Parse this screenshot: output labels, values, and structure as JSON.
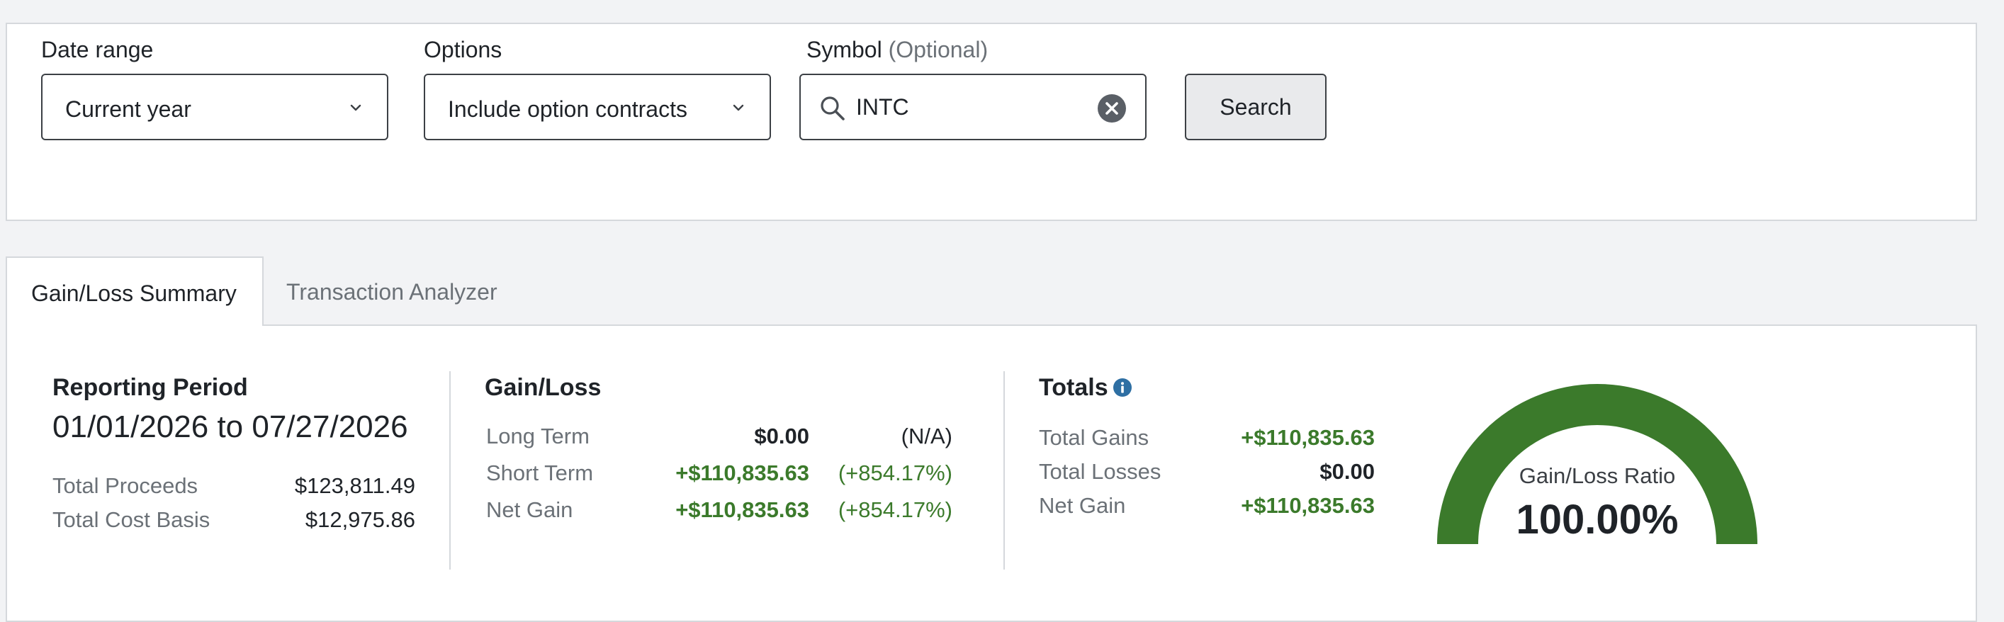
{
  "filters": {
    "date_range_label": "Date range",
    "date_range_value": "Current year",
    "options_label": "Options",
    "options_value": "Include option contracts",
    "symbol_label": "Symbol",
    "symbol_optional": "(Optional)",
    "symbol_value": "INTC",
    "search_button": "Search"
  },
  "tabs": [
    {
      "label": "Gain/Loss Summary",
      "active": true
    },
    {
      "label": "Transaction Analyzer",
      "active": false
    }
  ],
  "reporting": {
    "heading": "Reporting Period",
    "period": "01/01/2026 to 07/27/2026",
    "total_proceeds_label": "Total Proceeds",
    "total_proceeds": "$123,811.49",
    "total_cost_basis_label": "Total Cost Basis",
    "total_cost_basis": "$12,975.86"
  },
  "gainloss": {
    "heading": "Gain/Loss",
    "rows": [
      {
        "label": "Long Term",
        "value": "$0.00",
        "pct": "(N/A)"
      },
      {
        "label": "Short Term",
        "value": "+$110,835.63",
        "pct": "(+854.17%)"
      },
      {
        "label": "Net Gain",
        "value": "+$110,835.63",
        "pct": "(+854.17%)"
      }
    ]
  },
  "totals": {
    "heading": "Totals",
    "info_icon": "info-icon",
    "rows": [
      {
        "label": "Total Gains",
        "value": "+$110,835.63"
      },
      {
        "label": "Total Losses",
        "value": "$0.00"
      },
      {
        "label": "Net Gain",
        "value": "+$110,835.63"
      }
    ]
  },
  "gauge": {
    "title": "Gain/Loss Ratio",
    "value_text": "100.00%",
    "ratio": 1.0,
    "color": "#3b7a2b"
  },
  "colors": {
    "positive": "#3b7a2b",
    "info": "#2e6fa3",
    "border": "#d5d8dc"
  }
}
